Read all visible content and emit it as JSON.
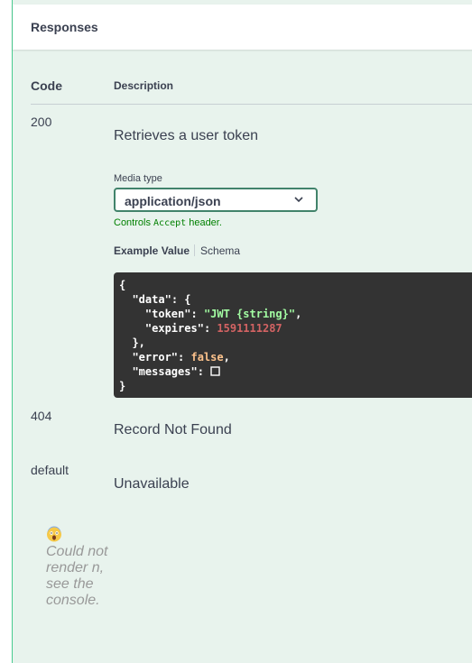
{
  "responses": {
    "title": "Responses",
    "col_code": "Code",
    "col_description": "Description"
  },
  "rows": [
    {
      "code": "200",
      "description": "Retrieves a user token"
    },
    {
      "code": "404",
      "description": "Record Not Found"
    },
    {
      "code": "default",
      "description": "Unavailable"
    }
  ],
  "media": {
    "label": "Media type",
    "value": "application/json",
    "controls_prefix": "Controls ",
    "controls_code": "Accept",
    "controls_suffix": " header."
  },
  "tabs": {
    "example": "Example Value",
    "schema": "Schema"
  },
  "example_json": {
    "open": "{",
    "data_key": "\"data\"",
    "token_key": "\"token\"",
    "token_val": "\"JWT {string}\"",
    "expires_key": "\"expires\"",
    "expires_val": "1591111287",
    "close_inner": "},",
    "error_key": "\"error\"",
    "error_val": "false",
    "messages_key": "\"messages\"",
    "close": "}"
  },
  "error": {
    "emoji": "😱",
    "message": "Could not render n, see the console."
  },
  "colors": {
    "panel_bg": "#e8f3ed",
    "accent_green": "#49cc90",
    "select_border": "#41836b",
    "code_bg": "#333333"
  }
}
